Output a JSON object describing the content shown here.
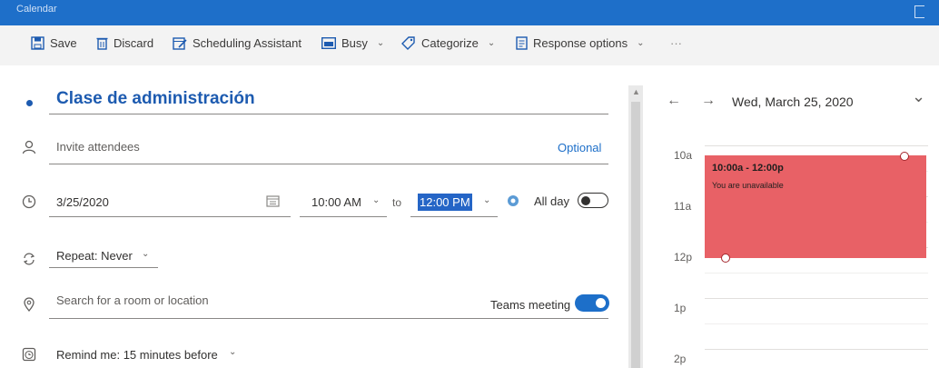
{
  "window": {
    "title": "Calendar"
  },
  "toolbar": {
    "save": "Save",
    "discard": "Discard",
    "scheduling": "Scheduling Assistant",
    "busy": "Busy",
    "categorize": "Categorize",
    "response": "Response options",
    "more": "···"
  },
  "event": {
    "title": "Clase de administración",
    "attendees_placeholder": "Invite attendees",
    "optional_label": "Optional",
    "date": "3/25/2020",
    "start_time": "10:00 AM",
    "to_label": "to",
    "end_time": "12:00 PM",
    "all_day_label": "All day",
    "all_day": false,
    "repeat": "Repeat: Never",
    "location_placeholder": "Search for a room or location",
    "teams_label": "Teams meeting",
    "teams_meeting": true,
    "remind": "Remind me: 15 minutes before"
  },
  "side": {
    "prev": "←",
    "next": "→",
    "date_label": "Wed, March 25, 2020",
    "expand": "⌄",
    "hours": [
      "10a",
      "11a",
      "12p",
      "1p",
      "2p"
    ],
    "event_time": "10:00a - 12:00p",
    "event_status": "You are unavailable"
  },
  "colors": {
    "accent": "#1d6fc9",
    "titlebar": "#1e6fc9",
    "event_busy": "#e86166",
    "title_text": "#1d5bb0"
  }
}
